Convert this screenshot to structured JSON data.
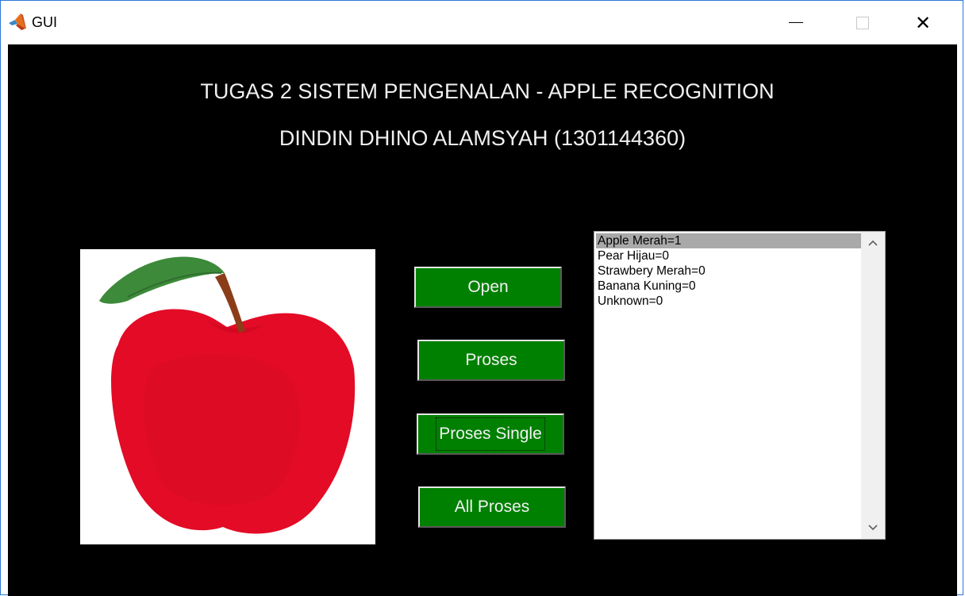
{
  "window": {
    "title": "GUI",
    "controls": {
      "minimize": "minimize",
      "maximize": "maximize",
      "close": "close"
    }
  },
  "header": {
    "line1": "TUGAS 2 SISTEM PENGENALAN - APPLE RECOGNITION",
    "line2": "DINDIN DHINO ALAMSYAH (1301144360)"
  },
  "image_panel": {
    "content": "apple-image"
  },
  "buttons": {
    "open": "Open",
    "proses": "Proses",
    "proses_single": "Proses Single",
    "all_proses": "All Proses"
  },
  "results": {
    "items": [
      "Apple Merah=1",
      "Pear Hijau=0",
      "Strawbery Merah=0",
      "Banana Kuning=0",
      "Unknown=0"
    ],
    "selected_index": 0
  },
  "colors": {
    "client_bg": "#000000",
    "button_bg": "#008000",
    "apple_red": "#e30b26",
    "leaf_green": "#3d8a3a",
    "stem_brown": "#8b3d1a"
  }
}
